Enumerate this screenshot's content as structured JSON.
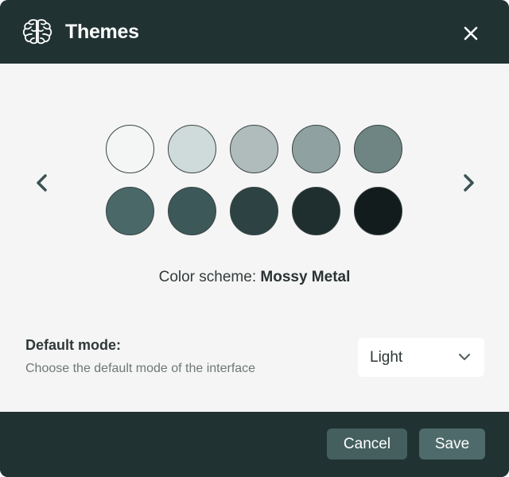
{
  "dialog": {
    "title": "Themes",
    "logo_icon": "brain-icon",
    "close_icon": "close-icon"
  },
  "swatches": {
    "prev_icon": "chevron-left-icon",
    "next_icon": "chevron-right-icon",
    "colors": [
      "#f4f6f6",
      "#cfdada",
      "#b0bcbc",
      "#8fa1a1",
      "#6e8583",
      "#4a6868",
      "#3d5858",
      "#2d4343",
      "#1f2f2f",
      "#131c1c"
    ]
  },
  "scheme": {
    "prefix": "Color scheme:",
    "name": "Mossy Metal"
  },
  "default_mode": {
    "title": "Default mode:",
    "description": "Choose the default mode of the interface",
    "selected": "Light",
    "dropdown_icon": "chevron-down-icon"
  },
  "footer": {
    "cancel_label": "Cancel",
    "save_label": "Save"
  }
}
